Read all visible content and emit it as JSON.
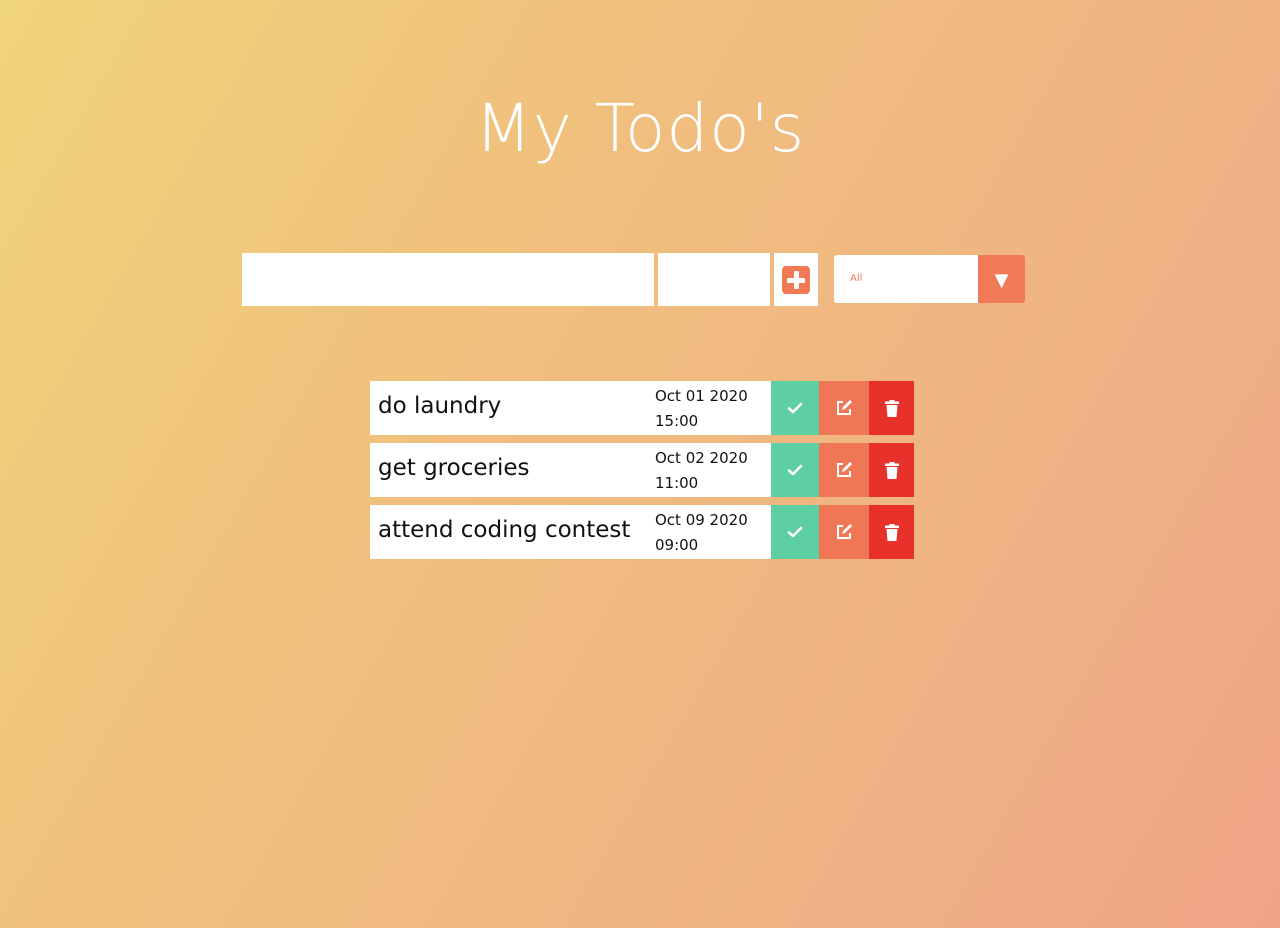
{
  "header": {
    "title": "My Todo's"
  },
  "form": {
    "todo_input_value": "",
    "date_input_value": "",
    "add_button": "plus-square-icon",
    "filter_selected": "All",
    "filter_arrow": "▼"
  },
  "todos": [
    {
      "text": "do laundry",
      "date": "Oct 01 2020",
      "time": "15:00"
    },
    {
      "text": "get groceries",
      "date": "Oct 02 2020",
      "time": "11:00"
    },
    {
      "text": "attend coding contest",
      "date": "Oct 09 2020",
      "time": "09:00"
    }
  ],
  "icons": {
    "complete": "check-icon",
    "edit": "edit-icon",
    "delete": "trash-icon"
  },
  "colors": {
    "accent": "#ef7a55",
    "complete": "#5ecfa2",
    "delete": "#e8312a",
    "background_start": "#f0d47a",
    "background_end": "#efa487"
  }
}
